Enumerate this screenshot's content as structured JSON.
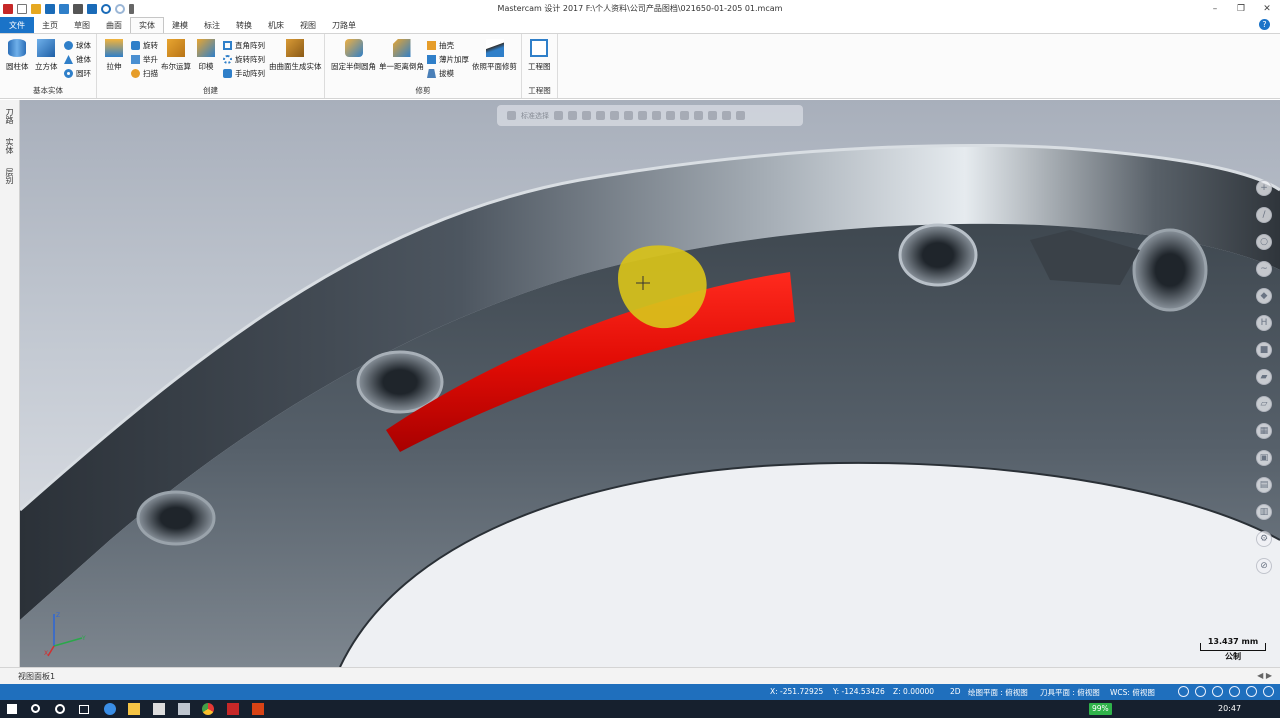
{
  "window": {
    "title": "Mastercam 设计 2017  F:\\个人资料\\公司产品图档\\021650-01-205  01.mcam",
    "controls": {
      "minimize": "–",
      "restore": "❐",
      "close": "✕"
    }
  },
  "tabs": [
    "文件",
    "主页",
    "草图",
    "曲面",
    "实体",
    "建模",
    "标注",
    "转换",
    "机床",
    "视图",
    "刀路单"
  ],
  "active_tab": "实体",
  "help_label": "?",
  "ribbon": {
    "basic_solids": {
      "label": "基本实体",
      "cylinder": "圆柱体",
      "cube": "立方体",
      "sphere": "球体",
      "cone": "锥体",
      "torus": "圆环"
    },
    "create": {
      "label": "创建",
      "extrude": "拉伸",
      "revolve": "旋转",
      "loft": "举升",
      "sweep": "扫描",
      "boolean": "布尔运算",
      "imprint": "印模",
      "rect_array": "直角阵列",
      "rotary_array": "旋转阵列",
      "manual_array": "手动阵列",
      "surface_to_solid": "由曲面生成实体"
    },
    "modify": {
      "label": "修剪",
      "fillet": "固定半倒圆角",
      "chamfer": "单一距离倒角",
      "shell": "抽壳",
      "thicken": "薄片加厚",
      "draft": "拔模",
      "trim_by_plane": "依照平面修剪"
    },
    "drawing": {
      "label": "工程图",
      "layout": "工程图"
    }
  },
  "left_panel_tabs": [
    "刀路",
    "实体",
    "层别"
  ],
  "selection_bar": {
    "label": "标准选择"
  },
  "scale": {
    "value": "13.437 mm",
    "unit": "公制"
  },
  "triad": {
    "x_label": "X",
    "y_label": "Y",
    "z_label": "Z"
  },
  "viewsheet": {
    "tab": "视图面板1",
    "nav": "◀ ▶"
  },
  "status": {
    "x": "X:  -251.72925",
    "y": "Y:  -124.53426",
    "z": "Z:  0.00000",
    "mode": "2D",
    "cplane": "绘图平面 : 俯视图",
    "tplane": "刀具平面 : 俯视图",
    "wcs": "WCS: 俯视图"
  },
  "taskbar": {
    "battery": "99%",
    "clock": "20:47"
  },
  "colors": {
    "ribbon_blue": "#1a73c8",
    "status_blue": "#1f6fbd",
    "selected_face": "#e00000",
    "highlight_face": "#d8c21a"
  }
}
